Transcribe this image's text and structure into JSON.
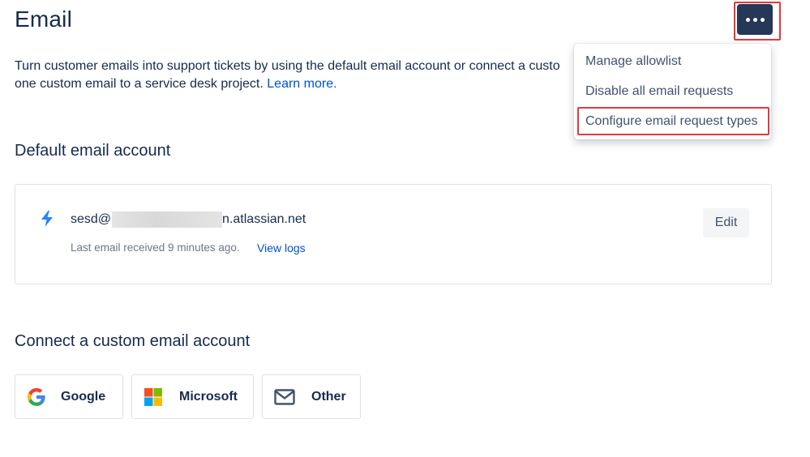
{
  "header": {
    "title": "Email",
    "more_button_icon": "more-horizontal-icon"
  },
  "intro": {
    "text": "Turn customer emails into support tickets by using the default email account or connect a custo",
    "text_line2": "one custom email to a service desk project.",
    "learn_more": "Learn more."
  },
  "default_account": {
    "heading": "Default email account",
    "icon": "lightning-bolt-icon",
    "email_prefix": "sesd@",
    "email_suffix": "n.atlassian.net",
    "last_email": "Last email received 9 minutes ago.",
    "view_logs": "View logs",
    "edit_label": "Edit"
  },
  "connect": {
    "heading": "Connect a custom email account",
    "providers": [
      {
        "label": "Google",
        "icon": "google-icon"
      },
      {
        "label": "Microsoft",
        "icon": "microsoft-icon"
      },
      {
        "label": "Other",
        "icon": "envelope-icon"
      }
    ]
  },
  "menu": {
    "items": [
      {
        "label": "Manage allowlist"
      },
      {
        "label": "Disable all email requests"
      },
      {
        "label": "Configure email request types"
      }
    ]
  },
  "colors": {
    "primary_text": "#172b4d",
    "link": "#0052cc",
    "more_button_bg": "#253858",
    "highlight": "#e5383b",
    "bolt": "#2684ff"
  }
}
